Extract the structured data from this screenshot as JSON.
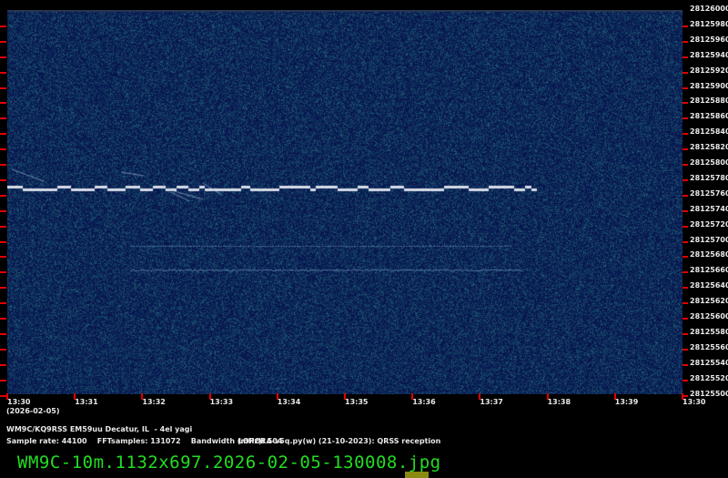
{
  "y_axis_labels": [
    "28126000",
    "28125980",
    "28125960",
    "28125940",
    "28125920",
    "28125900",
    "28125880",
    "28125860",
    "28125840",
    "28125820",
    "28125800",
    "28125780",
    "28125760",
    "28125740",
    "28125720",
    "28125700",
    "28125680",
    "28125660",
    "28125640",
    "28125620",
    "28125600",
    "28125580",
    "28125560",
    "28125540",
    "28125520",
    "28125500"
  ],
  "x_axis_labels": [
    "13:30",
    "13:31",
    "13:32",
    "13:33",
    "13:34",
    "13:35",
    "13:36",
    "13:37",
    "13:38",
    "13:39",
    "13:30"
  ],
  "date": "(2026-02-05)",
  "station": "WM9C/KQ9RSS EM59uu Decatur, IL  - 4el yagi",
  "params": "Sample rate: 44100    FFTsamples: 131072    Bandwidth (mHz): 504",
  "software": "LOPORA-v5q.py(w) (21-10-2023): QRSS reception",
  "filename": "WM9C-10m.1132x697.2026-02-05-130008.jpg",
  "colors": {
    "background": "#0a1a4a",
    "signal": "#d8dde8",
    "tick": "#e00000",
    "filename": "#22dd22"
  }
}
